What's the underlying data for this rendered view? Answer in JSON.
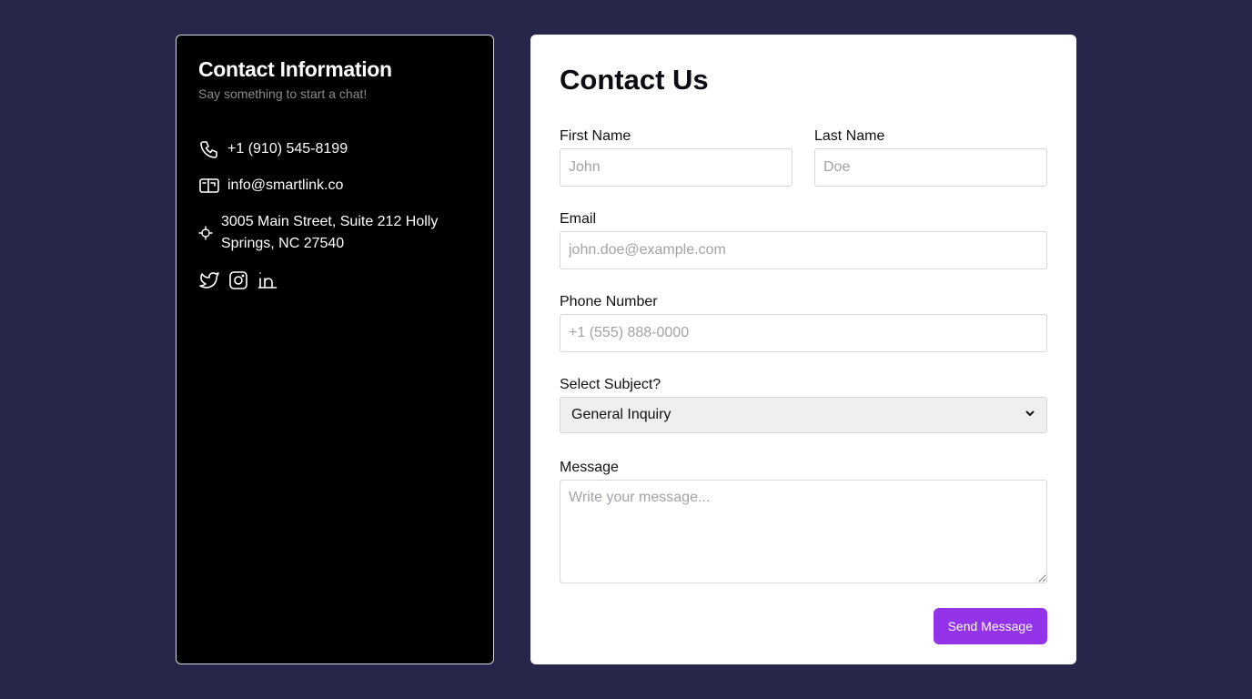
{
  "info": {
    "title": "Contact Information",
    "subtitle": "Say something to start a chat!",
    "phone": "+1 (910) 545-8199",
    "email": "info@smartlink.co",
    "address": "3005 Main Street, Suite 212 Holly Springs, NC 27540",
    "social_icons": [
      "twitter-icon",
      "instagram-icon",
      "linkedin-icon"
    ]
  },
  "form": {
    "title": "Contact Us",
    "first_name_label": "First Name",
    "first_name_placeholder": "John",
    "last_name_label": "Last Name",
    "last_name_placeholder": "Doe",
    "email_label": "Email",
    "email_placeholder": "john.doe@example.com",
    "phone_label": "Phone Number",
    "phone_placeholder": "+1 (555) 888-0000",
    "subject_label": "Select Subject?",
    "subject_value": "General Inquiry",
    "message_label": "Message",
    "message_placeholder": "Write your message...",
    "submit_label": "Send Message"
  },
  "colors": {
    "background": "#26254a",
    "info_card": "#000000",
    "accent": "#9333ea"
  }
}
